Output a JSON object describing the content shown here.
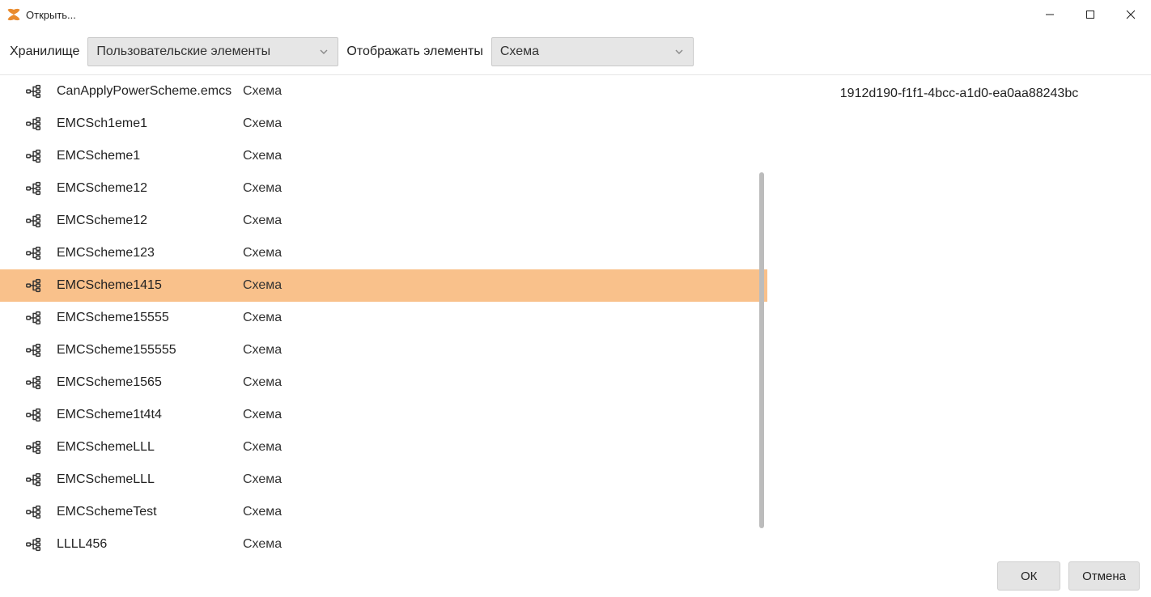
{
  "window": {
    "title": "Открыть..."
  },
  "toolbar": {
    "storage_label": "Хранилище",
    "storage_value": "Пользовательские элементы",
    "display_label": "Отображать элементы",
    "display_value": "Схема"
  },
  "list": {
    "selected_index": 6,
    "items": [
      {
        "name": "CanApplyPowerScheme.emcs",
        "type": "Схема"
      },
      {
        "name": "EMCSch1eme1",
        "type": "Схема"
      },
      {
        "name": "EMCScheme1",
        "type": "Схема"
      },
      {
        "name": "EMCScheme12",
        "type": "Схема"
      },
      {
        "name": "EMCScheme12",
        "type": "Схема"
      },
      {
        "name": "EMCScheme123",
        "type": "Схема"
      },
      {
        "name": "EMCScheme1415",
        "type": "Схема"
      },
      {
        "name": "EMCScheme15555",
        "type": "Схема"
      },
      {
        "name": "EMCScheme155555",
        "type": "Схема"
      },
      {
        "name": "EMCScheme1565",
        "type": "Схема"
      },
      {
        "name": "EMCScheme1t4t4",
        "type": "Схема"
      },
      {
        "name": "EMCSchemeLLL",
        "type": "Схема"
      },
      {
        "name": "EMCSchemeLLL",
        "type": "Схема"
      },
      {
        "name": "EMCSchemeTest",
        "type": "Схема"
      },
      {
        "name": "LLLL456",
        "type": "Схема"
      }
    ]
  },
  "preview": {
    "id_text": "1912d190-f1f1-4bcc-a1d0-ea0aa88243bc"
  },
  "footer": {
    "ok_label": "ОК",
    "cancel_label": "Отмена"
  }
}
